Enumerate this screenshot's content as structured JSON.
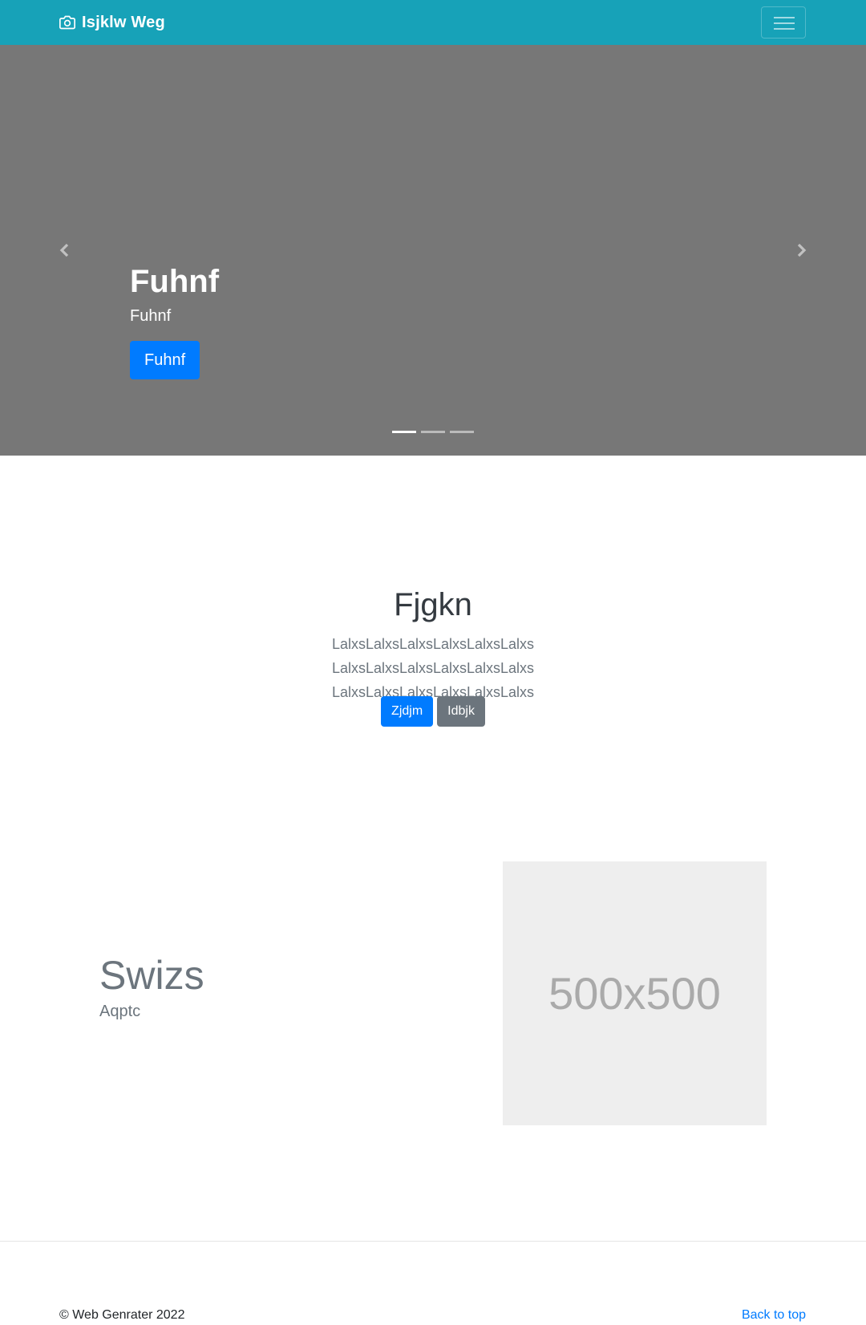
{
  "header": {
    "brand_icon": "camera-icon",
    "brand_text": "Isjklw Weg",
    "toggler_icon": "hamburger-menu-icon",
    "bg_color": "#17a2b8"
  },
  "carousel": {
    "bg_color": "#777777",
    "prev_icon": "chevron-left-icon",
    "next_icon": "chevron-right-icon",
    "caption": {
      "title": "Fuhnf",
      "text": "Fuhnf",
      "button_label": "Fuhnf"
    },
    "indicators": {
      "count": 3,
      "active_index": 0
    }
  },
  "jumbotron": {
    "title": "Fjgkn",
    "lead": "LalxsLalxsLalxsLalxsLalxsLalxs LalxsLalxsLalxsLalxsLalxsLalxs LalxsLalxsLalxsLalxsLalxsLalxs",
    "primary_button": "Zjdjm",
    "secondary_button": "Idbjk"
  },
  "feature": {
    "heading": "Swizs",
    "subheading": "Aqptc",
    "image_placeholder": "500x500"
  },
  "footer": {
    "copyright": "© Web Genrater 2022",
    "back_to_top": "Back to top"
  },
  "colors": {
    "primary": "#007bff",
    "secondary": "#6c757d",
    "placeholder_bg": "#eeeeee",
    "placeholder_text": "#aaaaaa"
  }
}
